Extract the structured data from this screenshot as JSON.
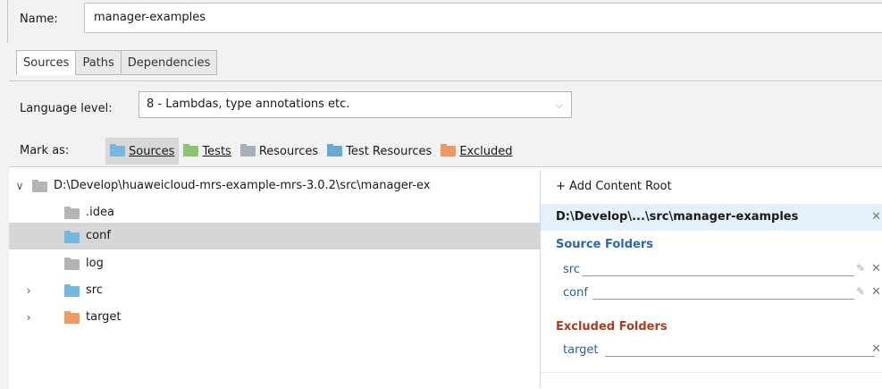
{
  "name": {
    "label": "Name:",
    "value": "manager-examples"
  },
  "tabs": [
    {
      "label": "Sources",
      "active": true
    },
    {
      "label": "Paths",
      "active": false
    },
    {
      "label": "Dependencies",
      "active": false
    }
  ],
  "language": {
    "label": "Language level:",
    "value": "8 - Lambdas, type annotations etc."
  },
  "mark": {
    "label": "Mark as:",
    "buttons": [
      {
        "label": "Sources",
        "icon": "sources-folder-icon",
        "active": true
      },
      {
        "label": "Tests",
        "icon": "tests-folder-icon"
      },
      {
        "label": "Resources",
        "icon": "resources-folder-icon"
      },
      {
        "label": "Test Resources",
        "icon": "test-resources-folder-icon"
      },
      {
        "label": "Excluded",
        "icon": "excluded-folder-icon"
      }
    ]
  },
  "tree": {
    "root": "D:\\Develop\\huaweicloud-mrs-example-mrs-3.0.2\\src\\manager-ex",
    "items": [
      {
        "label": ".idea",
        "icon": "folder-icon"
      },
      {
        "label": "conf",
        "icon": "folder-icon",
        "selected": true
      },
      {
        "label": "log",
        "icon": "folder-icon"
      },
      {
        "label": "src",
        "icon": "source-folder-icon"
      },
      {
        "label": "target",
        "icon": "excluded-folder-icon"
      }
    ]
  },
  "popup": {
    "add_root": "+ Add Content Root",
    "header": "D:\\Develop\\...\\src\\manager-examples",
    "source_title": "Source Folders",
    "source_folders": [
      "src",
      "conf"
    ],
    "excluded_title": "Excluded Folders",
    "excluded_folders": [
      "target"
    ]
  },
  "colors": {
    "sources": "#75b8de",
    "tests": "#8bc570",
    "excluded": "#f09a60",
    "source_folder_text": "#2a68b4",
    "excluded_folder_text": "#b03a20"
  }
}
